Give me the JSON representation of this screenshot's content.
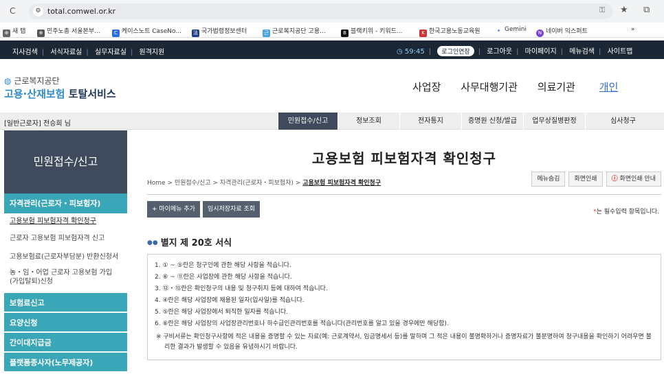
{
  "browser": {
    "url": "total.comwel.or.kr",
    "bookmarks": [
      "새 탭",
      "민주노총 서울본부...",
      "케이스노트 CaseNo...",
      "국가법령정보센터",
      "근로복지공단 고용...",
      "블랙키위 - 키워드...",
      "한국고용노동교육원",
      "Gemini",
      "네이버 익스퍼트"
    ]
  },
  "util": {
    "left": [
      "지사검색",
      "서식자료실",
      "실무자료실",
      "원격지원"
    ],
    "timer": "59:45",
    "extend_label": "로그인연장",
    "right": [
      "로그아웃",
      "마이페이지",
      "메뉴검색",
      "사이트맵"
    ]
  },
  "logo": {
    "line1": "근로복지공단",
    "line2a": "고용·산재보험",
    "line2b": "토탈서비스"
  },
  "gnb": [
    "사업장",
    "사무대행기관",
    "의료기관",
    "개인"
  ],
  "user": {
    "type": "[일반근로자]",
    "name": "전승희",
    "suffix": "님"
  },
  "menu": [
    "민원접수/신고",
    "정보조회",
    "전자통지",
    "증명원 신청/발급",
    "업무상질병판정",
    "심사청구"
  ],
  "sidebar": {
    "title": "민원접수/신고",
    "section1": "자격관리(근로자・피보험자)",
    "items": [
      "고용보험 피보험자격 확인청구",
      "근로자 고용보험 피보험자격 신고",
      "고용보험료(근로자부담분) 반환신청서",
      "농・임・어업 근로자 고용보험 가입 (가입탈퇴)신청"
    ],
    "sections": [
      "보험료신고",
      "요양신청",
      "간이대지급금",
      "플랫폼종사자(노무제공자)"
    ]
  },
  "page": {
    "title": "고용보험 피보험자격 확인청구",
    "crumbs": [
      "Home",
      "민원접수/신고",
      "자격관리(근로자・피보험자)",
      "고용보험 피보험자격 확인청구"
    ],
    "tools": [
      "메뉴숨김",
      "화면인쇄",
      "화면인쇄 안내"
    ],
    "buttons": [
      "+ 마이메뉴 추가",
      "임시저장자료 조회"
    ],
    "required_note": "는 필수입력 항목입니다.",
    "form_title": "별지 제 20호 서식",
    "instructions": [
      "1. ① ~ ⑤란은 청구인에 관한 해당 사항을 적습니다.",
      "2. ⑥ ~ ⑪란은 사업장에 관한 해당 사항을 적습니다.",
      "3. ⑫・⑬란은 확인청구의 내용 및 청구취지 등에 대하여 적습니다.",
      "4. ④란은 해당 사업장에 채용된 일자(입사일)를 적습니다.",
      "5. ⑤란은 해당 사업장에서 퇴직한 일자를 적습니다.",
      "6. ⑥란은 해당 사업장의 사업장관리번호나 하수급인관리번호를 적습니다(관리번호를 알고 있을 경우에만 해당함)."
    ],
    "note": "※ 구비서류는 확인청구사항에 적은 내용을 증명할 수 있는 자료(예: 근로계약서, 임금명세서 등)를 말하며 그 적은 내용이 불명확하거나 증명자료가 불분명하여 청구내용을 확인하기 어려우면 불리한 결과가 발생할 수 있음을 유념하시기 바랍니다."
  }
}
